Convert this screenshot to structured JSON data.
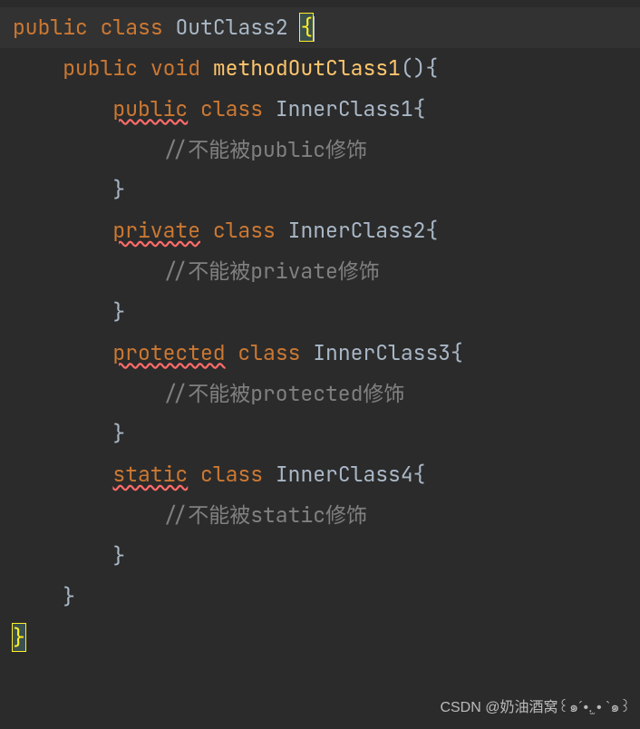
{
  "code": {
    "line1": {
      "kw_public": "public",
      "kw_class": "class",
      "classname": "OutClass2",
      "brace_open": "{"
    },
    "line2": {
      "kw_public": "public",
      "kw_void": "void",
      "methodname": "methodOutClass1",
      "parens_brace": "(){"
    },
    "line3": {
      "kw_public": "public",
      "kw_class": "class",
      "classname": "InnerClass1{"
    },
    "line4": {
      "comment": "//不能被public修饰"
    },
    "line5": {
      "brace": "}"
    },
    "line6": {
      "kw_private": "private",
      "kw_class": "class",
      "classname": "InnerClass2{"
    },
    "line7": {
      "comment": "//不能被private修饰"
    },
    "line8": {
      "brace": "}"
    },
    "line9": {
      "kw_protected": "protected",
      "kw_class": "class",
      "classname": "InnerClass3{"
    },
    "line10": {
      "comment": "//不能被protected修饰"
    },
    "line11": {
      "brace": "}"
    },
    "line12": {
      "kw_static": "static",
      "kw_class": "class",
      "classname": "InnerClass4{"
    },
    "line13": {
      "comment": "//不能被static修饰"
    },
    "line14": {
      "brace": "}"
    },
    "line15": {
      "brace": "}"
    },
    "line16": {
      "brace": "}"
    }
  },
  "watermark": "CSDN @奶油酒窝꒰๑´•.̫ • `๑꒱"
}
